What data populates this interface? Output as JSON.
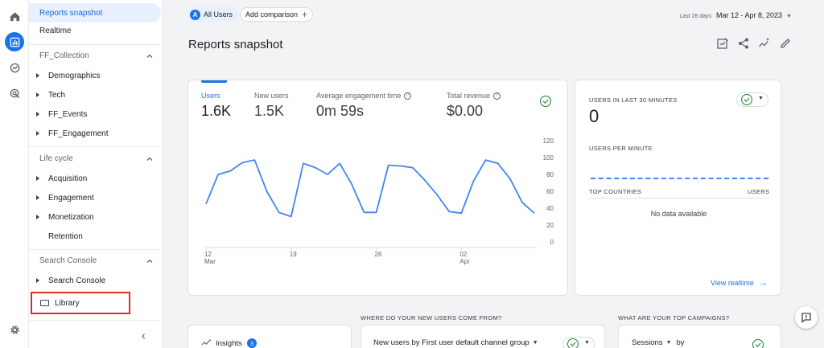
{
  "nav": {
    "reports_snapshot": "Reports snapshot",
    "realtime": "Realtime",
    "sections": [
      {
        "title": "FF_Collection",
        "items": [
          "Demographics",
          "Tech",
          "FF_Events",
          "FF_Engagement"
        ]
      },
      {
        "title": "Life cycle",
        "items": [
          "Acquisition",
          "Engagement",
          "Monetization",
          "Retention"
        ]
      },
      {
        "title": "Search Console",
        "items": [
          "Search Console"
        ]
      }
    ],
    "library": "Library"
  },
  "topbar": {
    "segment_initial": "A",
    "segment": "All Users",
    "add_comparison": "Add comparison",
    "date_prefix": "Last 28 days",
    "date_range": "Mar 12 - Apr 8, 2023"
  },
  "page_title": "Reports snapshot",
  "metrics": [
    {
      "label": "Users",
      "value": "1.6K"
    },
    {
      "label": "New users",
      "value": "1.5K"
    },
    {
      "label": "Average engagement time",
      "value": "0m 59s"
    },
    {
      "label": "Total revenue",
      "value": "$0.00"
    }
  ],
  "chart_data": {
    "type": "line",
    "x": [
      12,
      13,
      14,
      15,
      16,
      17,
      18,
      19,
      20,
      21,
      22,
      23,
      24,
      25,
      26,
      27,
      28,
      29,
      30,
      31,
      1,
      2,
      3,
      4,
      5,
      6,
      7,
      8
    ],
    "series": [
      {
        "name": "Users",
        "values": [
          45,
          80,
          84,
          94,
          97,
          60,
          35,
          30,
          93,
          88,
          80,
          93,
          68,
          35,
          35,
          91,
          90,
          88,
          73,
          56,
          36,
          34,
          72,
          97,
          93,
          75,
          47,
          34
        ]
      }
    ],
    "x_ticks": [
      {
        "day": "12",
        "month": "Mar"
      },
      {
        "day": "19",
        "month": ""
      },
      {
        "day": "26",
        "month": ""
      },
      {
        "day": "02",
        "month": "Apr"
      }
    ],
    "y_ticks": [
      "120",
      "100",
      "80",
      "60",
      "40",
      "20",
      "0"
    ],
    "ylim": [
      0,
      120
    ],
    "color": "#4285f4"
  },
  "realtime": {
    "users_last_30": "USERS IN LAST 30 MINUTES",
    "count": "0",
    "users_per_minute": "USERS PER MINUTE",
    "top_countries": "TOP COUNTRIES",
    "users": "USERS",
    "no_data": "No data available",
    "view_realtime": "View realtime"
  },
  "bottom": {
    "new_users_question": "WHERE DO YOUR NEW USERS COME FROM?",
    "campaigns_question": "WHAT ARE YOUR TOP CAMPAIGNS?",
    "insights": "Insights",
    "insights_count": "3",
    "new_users_by": "New users by First user default channel group",
    "sessions": "Sessions",
    "by": "by"
  },
  "colors": {
    "accent": "#1a73e8",
    "success": "#188038",
    "highlight_border": "#d32f2f"
  }
}
